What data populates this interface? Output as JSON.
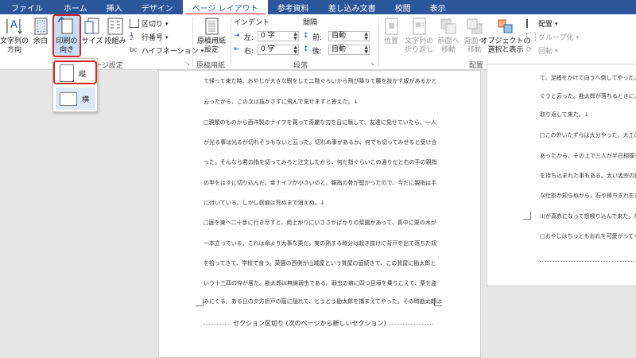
{
  "tabs": [
    "ファイル",
    "ホーム",
    "挿入",
    "デザイン",
    "ページ レイアウト",
    "参考資料",
    "差し込み文書",
    "校閲",
    "表示"
  ],
  "ribbon": {
    "page_setup": {
      "group_label": "ページ設定",
      "text_direction": "文字列の\n方向",
      "margins": "余白",
      "orientation": "印刷の\n向き",
      "size": "サイズ",
      "columns": "段組み",
      "breaks": "区切り",
      "line_numbers": "行番号",
      "hyphenation": "ハイフネーション"
    },
    "manuscript": {
      "group_label": "原稿用紙",
      "settings": "原稿用紙\n設定"
    },
    "paragraph": {
      "group_label": "段落",
      "indent_label": "インデント",
      "spacing_label": "間隔",
      "left_label": "左:",
      "right_label": "右:",
      "before_label": "前:",
      "after_label": "後:",
      "left_value": "0 字",
      "right_value": "0 字",
      "before_value": "自動",
      "after_value": "自動"
    },
    "arrange": {
      "group_label": "配置",
      "position": "位置",
      "wrap": "文字列の\n折り返し",
      "forward": "前面へ\n移動",
      "backward": "背面へ\n移動",
      "selection_pane": "オブジェクトの\n選択と表示",
      "align": "配置",
      "group": "グループ化",
      "rotate": "回転"
    }
  },
  "orientation_menu": {
    "portrait": "縦",
    "landscape": "横"
  },
  "document": {
    "main_page_lines": [
      "て帰って来た時、おやじが大きな眼をして二階ぐらいから飛び降りて腰を抜かす奴があるかと",
      "云ったから、この次は抜かさずに飛んで見せますと答えた。↓",
      "□親類のものから西洋製のナイフを貰って奇麗な刃を日に翳して、友達に見せていたら、一人",
      "が光る事は光るが切れそうもないと云った。切れぬ事があるか、何でも切ってみせると受け合",
      "った。そんなら君の指を切ってみろと注文したから、何だ指ぐらいこの通りだと右の手の親指",
      "の甲をはすに切り込んだ。幸ナイフが小さいのと、親指の骨が堅かったので、今だに親指は手",
      "に付いている。しかし創痕は死ぬまで消えぬ。↓",
      "□庭を東へ二十歩に行き尽すと、南上がりにいささかばかりの菜園があって、真中に栗の木が",
      "一本立っている。これは命より大事な栗だ。実の熟する時分は起き抜けに背戸を出て落ちた奴",
      "を拾ってきて、学校で食う。菜園の西側が山城屋という質屋の庭続きで、この質屋に勘太郎と",
      "いう十三四の伜が居た。勘太郎は無論弱虫である。弱虫の癖に四つ目垣を乗りこえて、栗を盗",
      "みにくる。ある日の夕方折戸の蔭に隠れて、とうとう勘太郎を捕まえてやった。その時勘太郎は"
    ],
    "section_break": "セクション区切り (次のページから新しいセクション)",
    "right_page_lines": [
      "て、足搔をかけて向うへ倒してやった。",
      "ぐうと云った。勘太郎が落ちるときに、",
      "取り返して来た。↓",
      "□この外いたずらは大分やった。大工の",
      "あったから、その上で三人が半日相撲を",
      "を持ち込まれた事もある。太い孟宗の節",
      "な仕掛か知らぬから、石や棒ちぎれをぎ",
      "川が真赤になって怒鳴り込んで来た。た",
      "□おやじはちっともおれを可愛がってく"
    ]
  },
  "colors": {
    "tab_bar": "#2b579a",
    "highlight": "#d8232a",
    "button_selected": "#c5dcf3"
  }
}
